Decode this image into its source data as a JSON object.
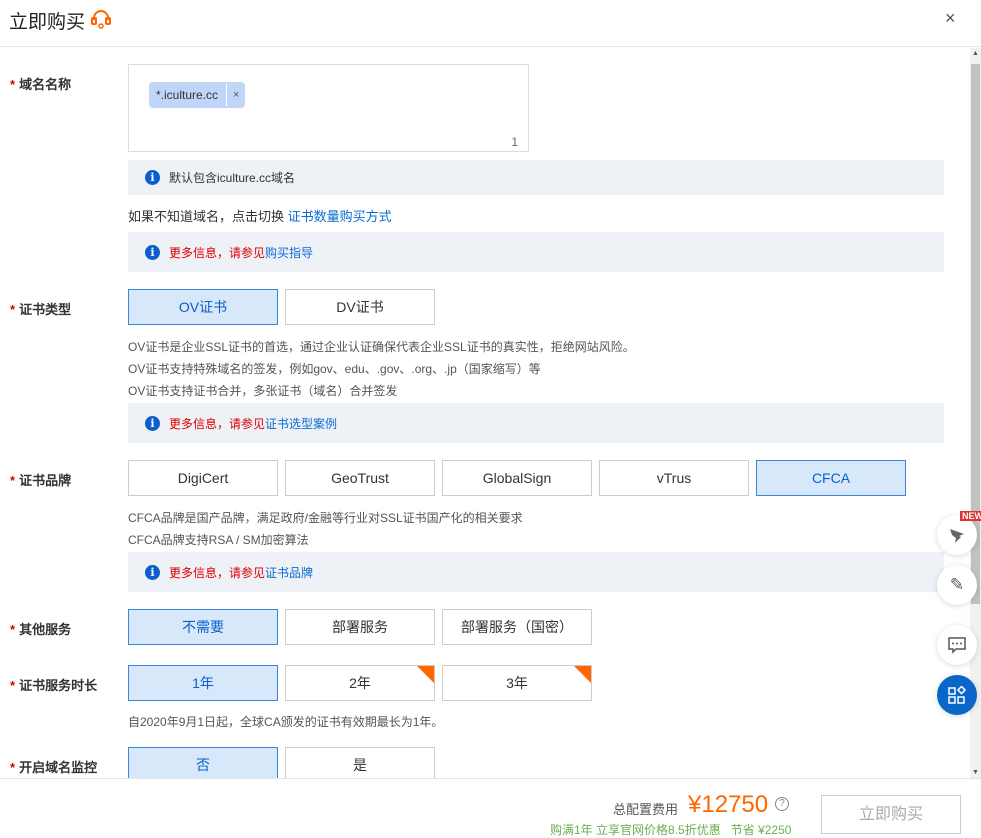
{
  "header": {
    "title": "立即购买",
    "close": "×"
  },
  "domain": {
    "label": "域名名称",
    "tag": "*.iculture.cc",
    "tag_remove": "×",
    "count": "1",
    "info": "默认包含iculture.cc域名",
    "switch_text": "如果不知道域名，点击切换 ",
    "switch_link": "证书数量购买方式",
    "more_red": "更多信息，请参见",
    "more_link": "购买指导"
  },
  "cert_type": {
    "label": "证书类型",
    "options": [
      "OV证书",
      "DV证书"
    ],
    "selected": "OV证书",
    "desc": [
      "OV证书是企业SSL证书的首选，通过企业认证确保代表企业SSL证书的真实性，拒绝网站风险。",
      "OV证书支持特殊域名的签发，例如gov、edu、.gov、.org、.jp（国家缩写）等",
      "OV证书支持证书合并，多张证书（域名）合并签发"
    ],
    "more_red": "更多信息，请参见",
    "more_link": "证书选型案例"
  },
  "brand": {
    "label": "证书品牌",
    "options": [
      "DigiCert",
      "GeoTrust",
      "GlobalSign",
      "vTrus",
      "CFCA"
    ],
    "selected": "CFCA",
    "desc": [
      "CFCA品牌是国产品牌，满足政府/金融等行业对SSL证书国产化的相关要求",
      "CFCA品牌支持RSA / SM加密算法"
    ],
    "more_red": "更多信息，请参见",
    "more_link": "证书品牌"
  },
  "service": {
    "label": "其他服务",
    "options": [
      "不需要",
      "部署服务",
      "部署服务（国密）"
    ],
    "selected": "不需要"
  },
  "duration": {
    "label": "证书服务时长",
    "options": [
      "1年",
      "2年",
      "3年"
    ],
    "selected": "1年",
    "discount_badge": "折",
    "note": "自2020年9月1日起，全球CA颁发的证书有效期最长为1年。"
  },
  "monitor": {
    "label": "开启域名监控",
    "options": [
      "否",
      "是"
    ],
    "selected": "否"
  },
  "footer": {
    "total_label": "总配置费用",
    "price": "¥12750",
    "help": "?",
    "promo": "购满1年 立享官网价格8.5折优惠",
    "save": "节省 ¥2250",
    "buy": "立即购买"
  },
  "float": {
    "new_badge": "NEW"
  },
  "colors": {
    "accent": "#0a5fcc",
    "price": "#ff6600",
    "required": "#dd0000"
  }
}
